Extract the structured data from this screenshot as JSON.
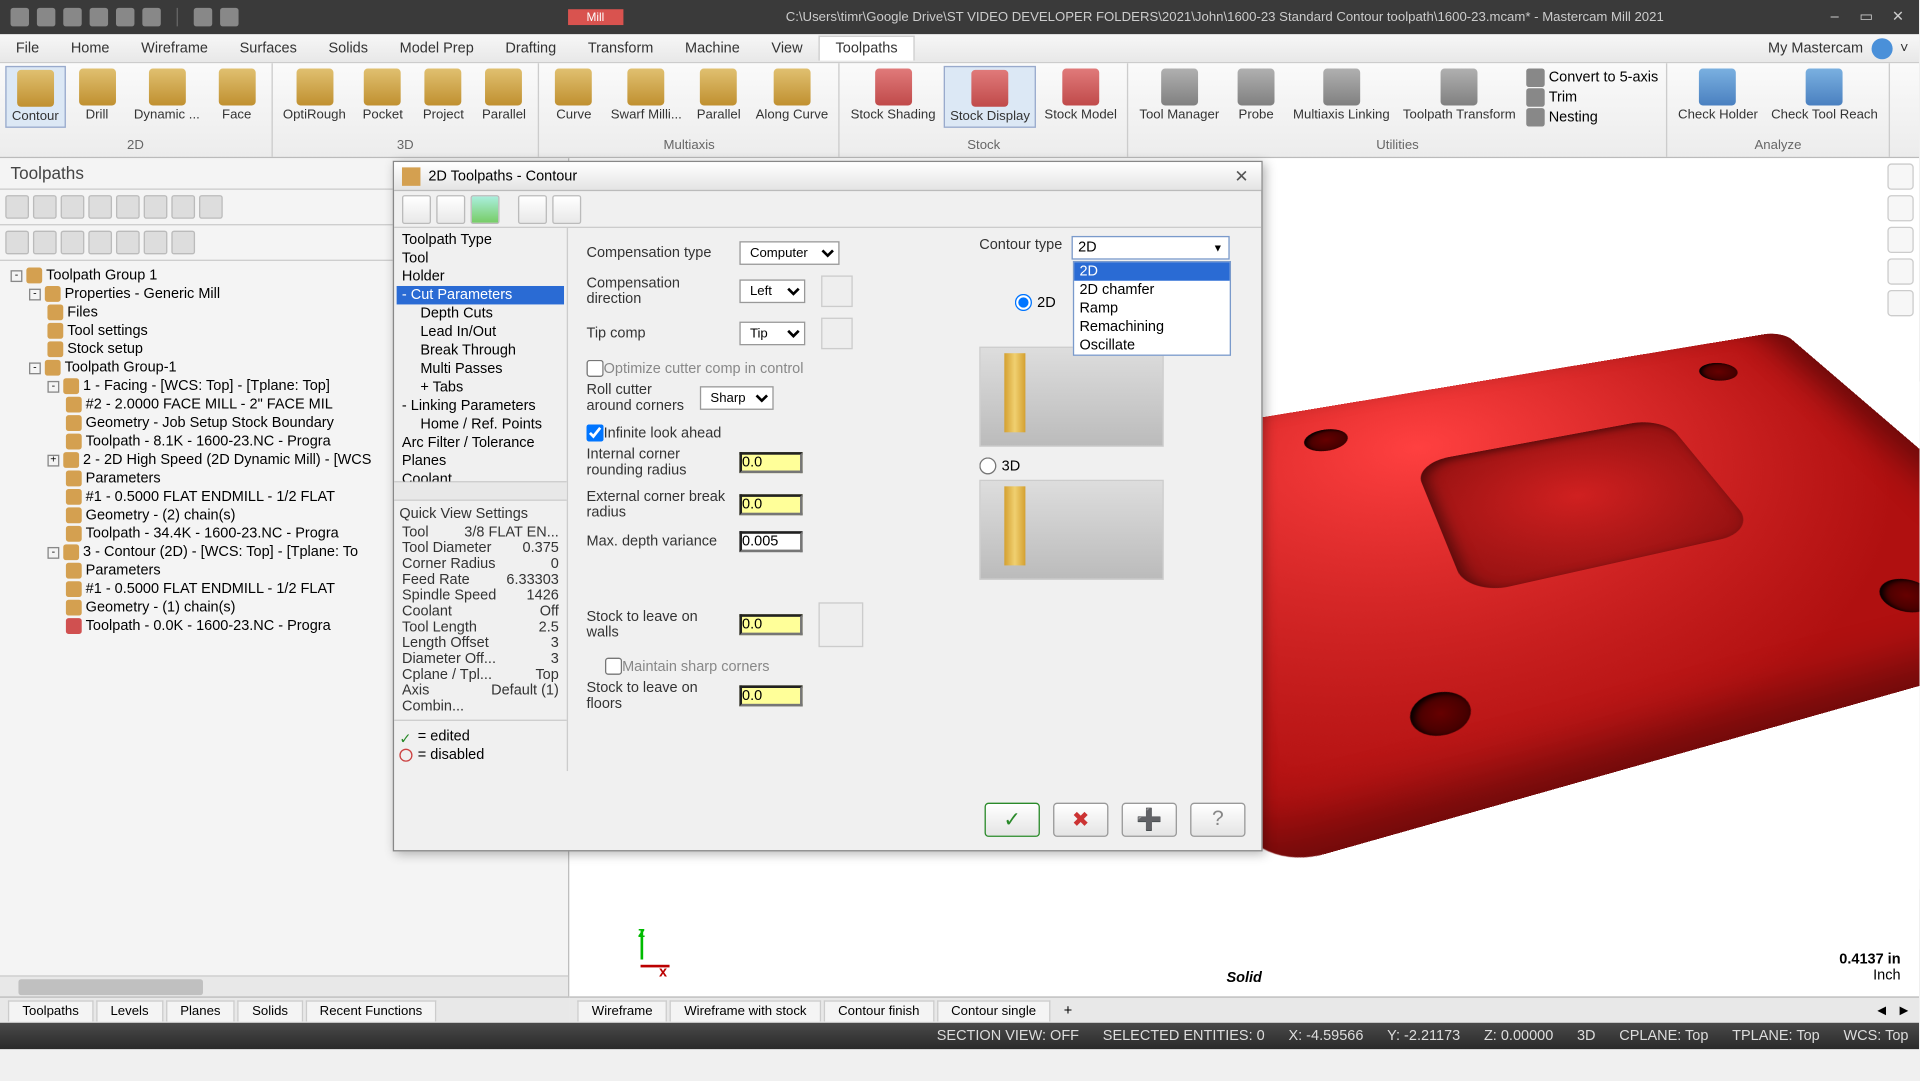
{
  "titlebar": {
    "path": "C:\\Users\\timr\\Google Drive\\ST VIDEO DEVELOPER FOLDERS\\2021\\John\\1600-23 Standard Contour toolpath\\1600-23.mcam* - Mastercam Mill 2021",
    "mill_badge": "Mill"
  },
  "menu": {
    "items": [
      "File",
      "Home",
      "Wireframe",
      "Surfaces",
      "Solids",
      "Model Prep",
      "Drafting",
      "Transform",
      "Machine",
      "View",
      "Toolpaths"
    ],
    "active": "Toolpaths",
    "account": "My Mastercam"
  },
  "ribbon": {
    "groups": [
      {
        "label": "2D",
        "items": [
          "Contour",
          "Drill",
          "Dynamic ...",
          "Face"
        ]
      },
      {
        "label": "3D",
        "items": [
          "OptiRough",
          "Pocket",
          "Project",
          "Parallel"
        ]
      },
      {
        "label": "Multiaxis",
        "items": [
          "Curve",
          "Swarf Milli...",
          "Parallel",
          "Along Curve"
        ]
      },
      {
        "label": "Stock",
        "items": [
          "Stock Shading",
          "Stock Display",
          "Stock Model"
        ]
      },
      {
        "label": "Utilities",
        "items": [
          "Tool Manager",
          "Probe",
          "Multiaxis Linking",
          "Toolpath Transform"
        ],
        "small": [
          "Convert to 5-axis",
          "Trim",
          "Nesting"
        ]
      },
      {
        "label": "Analyze",
        "items": [
          "Check Holder",
          "Check Tool Reach"
        ]
      }
    ]
  },
  "side": {
    "title": "Toolpaths",
    "tree": [
      {
        "l": 1,
        "t": "Toolpath Group 1",
        "exp": "-"
      },
      {
        "l": 2,
        "t": "Properties - Generic Mill",
        "exp": "-"
      },
      {
        "l": 3,
        "t": "Files"
      },
      {
        "l": 3,
        "t": "Tool settings"
      },
      {
        "l": 3,
        "t": "Stock setup"
      },
      {
        "l": 2,
        "t": "Toolpath Group-1",
        "exp": "-"
      },
      {
        "l": 3,
        "t": "1 - Facing - [WCS: Top] - [Tplane: Top]",
        "exp": "-"
      },
      {
        "l": 4,
        "t": "#2 - 2.0000 FACE MILL - 2\" FACE MIL"
      },
      {
        "l": 4,
        "t": "Geometry - Job Setup Stock Boundary"
      },
      {
        "l": 4,
        "t": "Toolpath - 8.1K - 1600-23.NC - Progra"
      },
      {
        "l": 3,
        "t": "2 - 2D High Speed (2D Dynamic Mill) - [WCS",
        "exp": "+"
      },
      {
        "l": 4,
        "t": "Parameters"
      },
      {
        "l": 4,
        "t": "#1 - 0.5000 FLAT ENDMILL - 1/2 FLAT"
      },
      {
        "l": 4,
        "t": "Geometry - (2) chain(s)"
      },
      {
        "l": 4,
        "t": "Toolpath - 34.4K - 1600-23.NC - Progra"
      },
      {
        "l": 3,
        "t": "3 - Contour (2D) - [WCS: Top] - [Tplane: To",
        "exp": "-"
      },
      {
        "l": 4,
        "t": "Parameters"
      },
      {
        "l": 4,
        "t": "#1 - 0.5000 FLAT ENDMILL - 1/2 FLAT"
      },
      {
        "l": 4,
        "t": "Geometry - (1) chain(s)"
      },
      {
        "l": 4,
        "t": "Toolpath - 0.0K - 1600-23.NC - Progra",
        "red": true
      }
    ]
  },
  "bottom_left": {
    "tabs": [
      "Toolpaths",
      "Levels",
      "Planes",
      "Solids",
      "Recent Functions"
    ]
  },
  "bottom_right": {
    "tabs": [
      "Wireframe",
      "Wireframe with stock",
      "Contour finish",
      "Contour single"
    ]
  },
  "viewport": {
    "scale_value": "0.4137 in",
    "scale_unit": "Inch",
    "solid_label": "Solid"
  },
  "status": {
    "section": "SECTION VIEW: OFF",
    "sel": "SELECTED ENTITIES: 0",
    "x": "X: -4.59566",
    "y": "Y: -2.21173",
    "z": "Z: 0.00000",
    "mode": "3D",
    "cplane": "CPLANE: Top",
    "tplane": "TPLANE: Top",
    "wcs": "WCS: Top"
  },
  "dialog": {
    "title": "2D Toolpaths - Contour",
    "tree": [
      {
        "l": 0,
        "t": "Toolpath Type"
      },
      {
        "l": 0,
        "t": "Tool"
      },
      {
        "l": 0,
        "t": "Holder"
      },
      {
        "l": 0,
        "t": "Cut Parameters",
        "sel": true,
        "exp": "-"
      },
      {
        "l": 1,
        "t": "Depth Cuts"
      },
      {
        "l": 1,
        "t": "Lead In/Out"
      },
      {
        "l": 1,
        "t": "Break Through"
      },
      {
        "l": 1,
        "t": "Multi Passes"
      },
      {
        "l": 1,
        "t": "Tabs",
        "exp": "+"
      },
      {
        "l": 0,
        "t": "Linking Parameters",
        "exp": "-"
      },
      {
        "l": 1,
        "t": "Home / Ref. Points"
      },
      {
        "l": 0,
        "t": "Arc Filter / Tolerance"
      },
      {
        "l": 0,
        "t": "Planes"
      },
      {
        "l": 0,
        "t": "Coolant"
      }
    ],
    "qv_title": "Quick View Settings",
    "qv": [
      {
        "k": "Tool",
        "v": "3/8 FLAT EN..."
      },
      {
        "k": "Tool Diameter",
        "v": "0.375"
      },
      {
        "k": "Corner Radius",
        "v": "0"
      },
      {
        "k": "Feed Rate",
        "v": "6.33303"
      },
      {
        "k": "Spindle Speed",
        "v": "1426"
      },
      {
        "k": "Coolant",
        "v": "Off"
      },
      {
        "k": "Tool Length",
        "v": "2.5"
      },
      {
        "k": "Length Offset",
        "v": "3"
      },
      {
        "k": "Diameter Off...",
        "v": "3"
      },
      {
        "k": "Cplane / Tpl...",
        "v": "Top"
      },
      {
        "k": "Axis Combin...",
        "v": "Default (1)"
      }
    ],
    "legend_edited": "= edited",
    "legend_disabled": "= disabled",
    "form": {
      "comp_type_label": "Compensation type",
      "comp_type": "Computer",
      "comp_dir_label": "Compensation direction",
      "comp_dir": "Left",
      "tip_label": "Tip comp",
      "tip": "Tip",
      "opt_cc": "Optimize cutter comp in control",
      "roll_label": "Roll cutter around corners",
      "roll": "Sharp",
      "inf_look": "Infinite look ahead",
      "int_rad_label": "Internal corner rounding radius",
      "int_rad": "0.0",
      "ext_rad_label": "External corner break radius",
      "ext_rad": "0.0",
      "max_dv_label": "Max. depth variance",
      "max_dv": "0.005",
      "stl_walls_label": "Stock to leave on walls",
      "stl_walls": "0.0",
      "maintain": "Maintain sharp corners",
      "stl_floor_label": "Stock to leave on floors",
      "stl_floor": "0.0",
      "ct_label": "Contour type",
      "ct_value": "2D",
      "ct_options": [
        "2D",
        "2D chamfer",
        "Ramp",
        "Remachining",
        "Oscillate"
      ],
      "r2d": "2D",
      "r3d": "3D"
    }
  }
}
